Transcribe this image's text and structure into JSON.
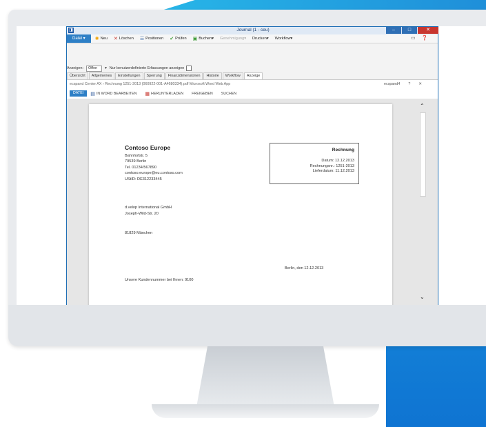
{
  "window": {
    "title": "Journal (1 - ceu)",
    "controls": [
      "–",
      "□",
      "✕"
    ]
  },
  "ribbon": {
    "file_label": "Datei",
    "items": [
      {
        "icon": "sun-icon",
        "label": "Neu"
      },
      {
        "icon": "delete-x-icon",
        "label": "Löschen"
      },
      {
        "icon": "list-icon",
        "label": "Positionen"
      },
      {
        "icon": "checkmark-icon",
        "label": "Prüfen"
      },
      {
        "icon": "booking-icon",
        "label": "Buchen▾"
      },
      {
        "icon": "none",
        "label": "Genehmigung▾",
        "disabled": true
      },
      {
        "icon": "none",
        "label": "Drucken▾"
      },
      {
        "icon": "none",
        "label": "Workflow▾"
      }
    ]
  },
  "filter": {
    "label": "Anzeigen:",
    "value": "Offen",
    "checkbox_label": "Nur benutzerdefinierte Erfassungen anzeigen",
    "checked": false
  },
  "tabs": [
    "Übersicht",
    "Allgemeines",
    "Einstellungen",
    "Sperrung",
    "Finanzdimensionen",
    "Historie",
    "Workflow",
    "Anzeige"
  ],
  "active_tab": "Anzeige",
  "viewer": {
    "breadcrumb": "ecspand Center AX › Rechnung 1251-2013 (060922-001-A4680334).pdf    Microsoft Word Web App",
    "user": "ecspand4",
    "help": "?",
    "close": "✕",
    "file_tab": "DATEI",
    "toolbar": [
      "IN WORD BEARBEITEN",
      "HERUNTERLADEN",
      "FREIGEBEN",
      "SUCHEN"
    ]
  },
  "document": {
    "company": "Contoso Europe",
    "address_lines": [
      "Bahnhofstr. 5",
      "79539 Berlin",
      "Tel. 01234/567890",
      "contoso.europe@eu.contoso.com",
      "UStID: DE312233445"
    ],
    "recipient_lines": [
      "d.velop International GmbH",
      "Joseph-Wild-Str. 20"
    ],
    "recipient_city": "81829 München",
    "invoice_title": "Rechnung",
    "invoice_lines": [
      "Datum: 12.12.2013",
      "Rechnungsnr.: 1251-2013",
      "Lieferdatum: 11.12.2013"
    ],
    "date_line": "Berlin, den 12.12.2013",
    "customer_line": "Unsere Kundennummer bei Ihnen: 9100"
  }
}
